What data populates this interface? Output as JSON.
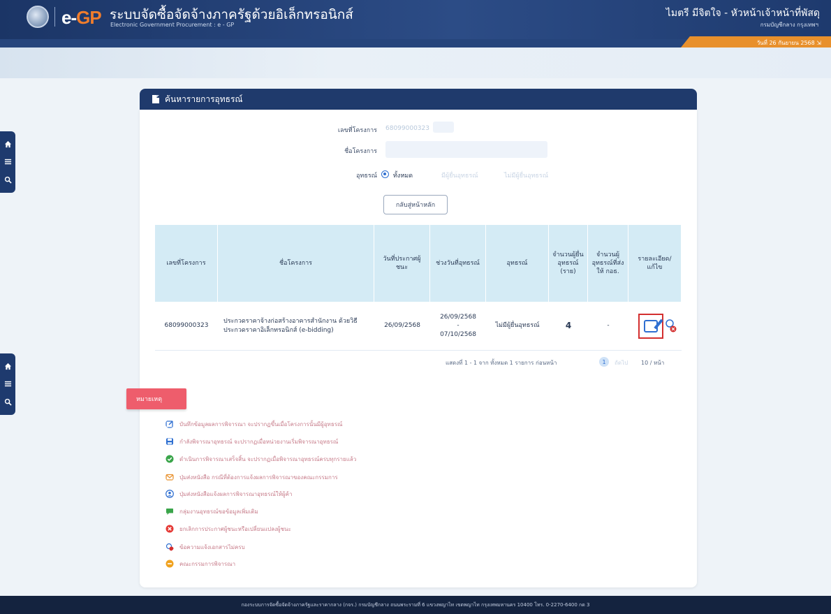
{
  "header": {
    "logo_e": "e-",
    "logo_gp": "GP",
    "system_title": "ระบบจัดซื้อจัดจ้างภาครัฐด้วยอิเล็กทรอนิกส์",
    "system_subtitle": "Electronic Government Procurement : e - GP",
    "user_name": "ไมตรี มีจิตใจ - หัวหน้าเจ้าหน้าที่พัสดุ",
    "user_department": "กรมบัญชีกลาง กรุงเทพฯ",
    "date_text": "วันที่ 26 กันยายน 2568"
  },
  "panel": {
    "title": "ค้นหารายการอุทธรณ์"
  },
  "form": {
    "project_no_label": "เลขที่โครงการ",
    "project_no_value": "68099000323",
    "project_name_label": "ชื่อโครงการ",
    "appeal_label": "อุทธรณ์",
    "radio_all": "ทั้งหมด",
    "radio_has_appeal": "มีผู้ยื่นอุทธรณ์",
    "radio_no_appeal": "ไม่มีผู้ยื่นอุทธรณ์",
    "back_button": "กลับสู่หน้าหลัก"
  },
  "table": {
    "headers": [
      "เลขที่โครงการ",
      "ชื่อโครงการ",
      "วันที่ประกาศผู้ชนะ",
      "ช่วงวันที่อุทธรณ์",
      "อุทธรณ์",
      "จำนวนผู้ยื่นอุทธรณ์ (ราย)",
      "จำนวนผู้อุทธรณ์ที่ส่งให้ กอธ.",
      "รายละเอียด/แก้ไข"
    ],
    "rows": [
      {
        "project_no": "68099000323",
        "project_name": "ประกวดราคาจ้างก่อสร้างอาคารสำนักงาน ด้วยวิธีประกวดราคาอิเล็กทรอนิกส์ (e-bidding)",
        "announce_date": "26/09/2568",
        "appeal_start": "26/09/2568",
        "appeal_dash": "-",
        "appeal_end": "07/10/2568",
        "appeal_status": "ไม่มีผู้ยื่นอุทธรณ์",
        "appellant_count": "4",
        "sent_count": "-"
      }
    ],
    "pagination_text": "แสดงที่ 1 - 1 จาก ทั้งหมด 1 รายการ   ก่อนหน้า",
    "pagination_next": "ถัดไป",
    "current_page": "1",
    "per_page": "10 / หน้า"
  },
  "legend": {
    "title": "หมายเหตุ",
    "items": [
      {
        "icon": "edit-icon",
        "color": "#2f6fd1",
        "text": "บันทึกข้อมูลผลการพิจารณา จะปรากฏขึ้นเมื่อโครงการนั้นมีผู้อุทธรณ์"
      },
      {
        "icon": "save-icon",
        "color": "#2f6fd1",
        "text": "กำลังพิจารณาอุทธรณ์ จะปรากฏเมื่อหน่วยงานเริ่มพิจารณาอุทธรณ์"
      },
      {
        "icon": "check-icon",
        "color": "#3aa54a",
        "text": "ดำเนินการพิจารณาเสร็จสิ้น จะปรากฏเมื่อพิจารณาอุทธรณ์ครบทุกรายแล้ว"
      },
      {
        "icon": "mail-icon",
        "color": "#e8902c",
        "text": "ปุ่มส่งหนังสือ กรณีที่ต้องการแจ้งผลการพิจารณาของคณะกรรมการ"
      },
      {
        "icon": "user-icon",
        "color": "#2f6fd1",
        "text": "ปุ่มส่งหนังสือแจ้งผลการพิจารณาอุทธรณ์ให้ผู้ค้า"
      },
      {
        "icon": "chat-icon",
        "color": "#3aa54a",
        "text": "กลุ่มงานอุทธรณ์ขอข้อมูลเพิ่มเติม"
      },
      {
        "icon": "cancel-icon",
        "color": "#e53935",
        "text": "ยกเลิกการประกาศผู้ชนะหรือเปลี่ยนแปลงผู้ชนะ"
      },
      {
        "icon": "doc-x-icon",
        "color": "#2f6fd1",
        "text": "ข้อความแจ้งเอกสารไม่ครบ"
      },
      {
        "icon": "pending-icon",
        "color": "#f0a21f",
        "text": "คณะกรรมการพิจารณา"
      }
    ]
  },
  "footer": {
    "text": "กองระบบการจัดซื้อจัดจ้างภาครัฐและราคากลาง (กจร.) กรมบัญชีกลาง ถนนพระรามที่ 6 แขวงพญาไท เขตพญาไท กรุงเทพมหานคร 10400 โทร. 0-2270-6400 กด 3"
  },
  "colors": {
    "header_bg": "#1f3a6c",
    "accent_orange": "#f07d2c",
    "table_header_bg": "#d4ebf5",
    "note_tag_bg": "#ee5d6c",
    "highlight_red": "#d32f2f"
  }
}
